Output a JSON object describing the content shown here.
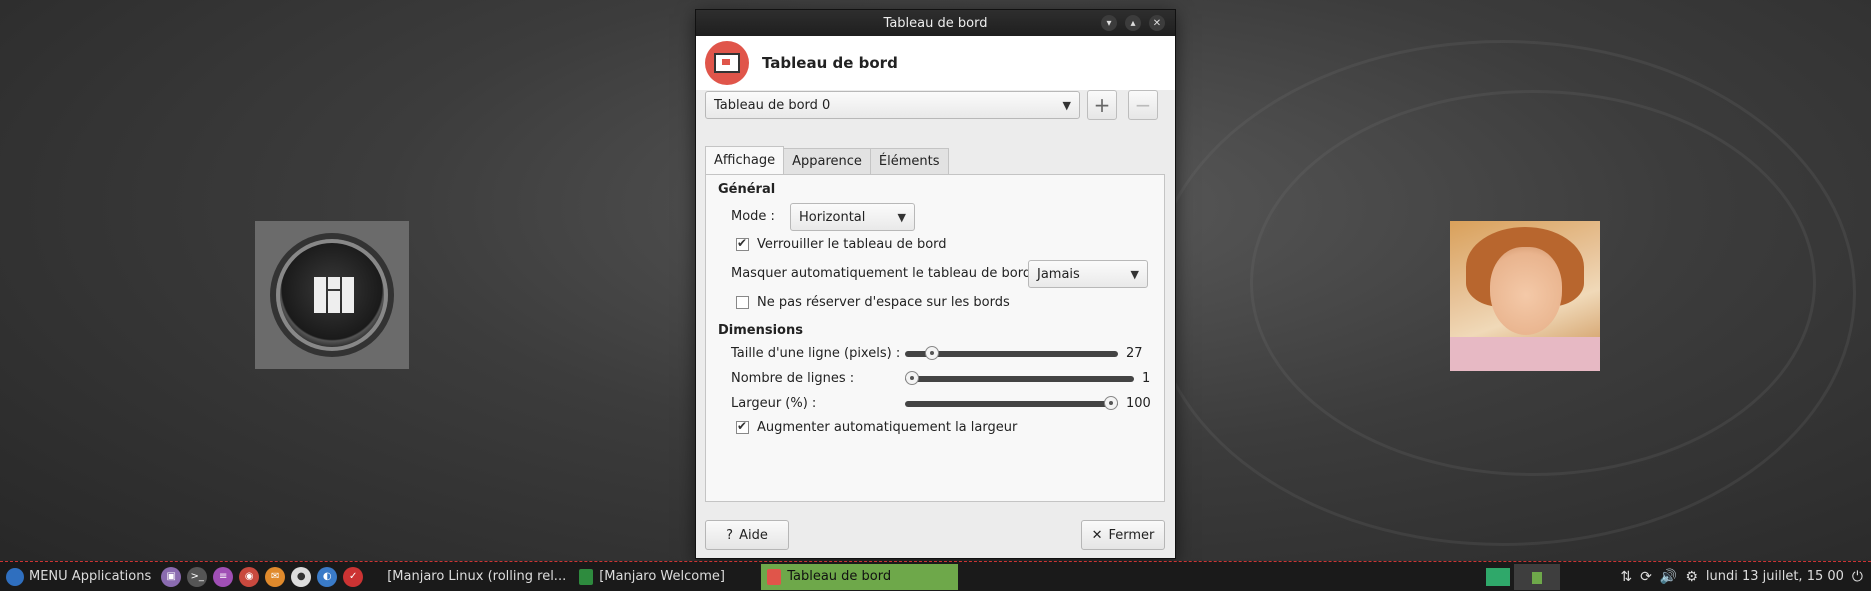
{
  "window": {
    "title": "Tableau de bord",
    "controls": [
      "minimize-icon",
      "maximize-icon",
      "close-icon"
    ]
  },
  "header": {
    "title": "Tableau de bord"
  },
  "panel_selector": {
    "value": "Tableau de bord 0",
    "add_label": "+",
    "remove_label": "−"
  },
  "tabs": [
    {
      "label": "Affichage",
      "active": true
    },
    {
      "label": "Apparence",
      "active": false
    },
    {
      "label": "Éléments",
      "active": false
    }
  ],
  "general": {
    "title": "Général",
    "mode_label": "Mode :",
    "mode_value": "Horizontal",
    "lock_label": "Verrouiller le tableau de bord",
    "lock_checked": true,
    "autohide_label": "Masquer automatiquement le tableau de bord :",
    "autohide_value": "Jamais",
    "noreserve_label": "Ne pas réserver d'espace sur les bords",
    "noreserve_checked": false
  },
  "dimensions": {
    "title": "Dimensions",
    "row_size_label": "Taille d'une ligne (pixels) :",
    "row_size_value": "27",
    "rows_label": "Nombre de lignes :",
    "rows_value": "1",
    "width_label": "Largeur (%) :",
    "width_value": "100",
    "autowidth_label": "Augmenter automatiquement la largeur",
    "autowidth_checked": true
  },
  "buttons": {
    "help": "Aide",
    "close": "Fermer"
  },
  "desktop": {
    "photo_caption": ""
  },
  "taskbar": {
    "menu_label": "MENU Applications",
    "tasks": [
      {
        "label": "[Manjaro Linux (rolling rel...",
        "active": false
      },
      {
        "label": "[Manjaro Welcome]",
        "active": false
      },
      {
        "label": "Tableau de bord",
        "active": true
      }
    ],
    "clock": "lundi 13 juillet, 15 00"
  },
  "colors": {
    "accent": "#e0554a",
    "active_task": "#6ea84a",
    "taskbar_border": "#cc3333"
  }
}
